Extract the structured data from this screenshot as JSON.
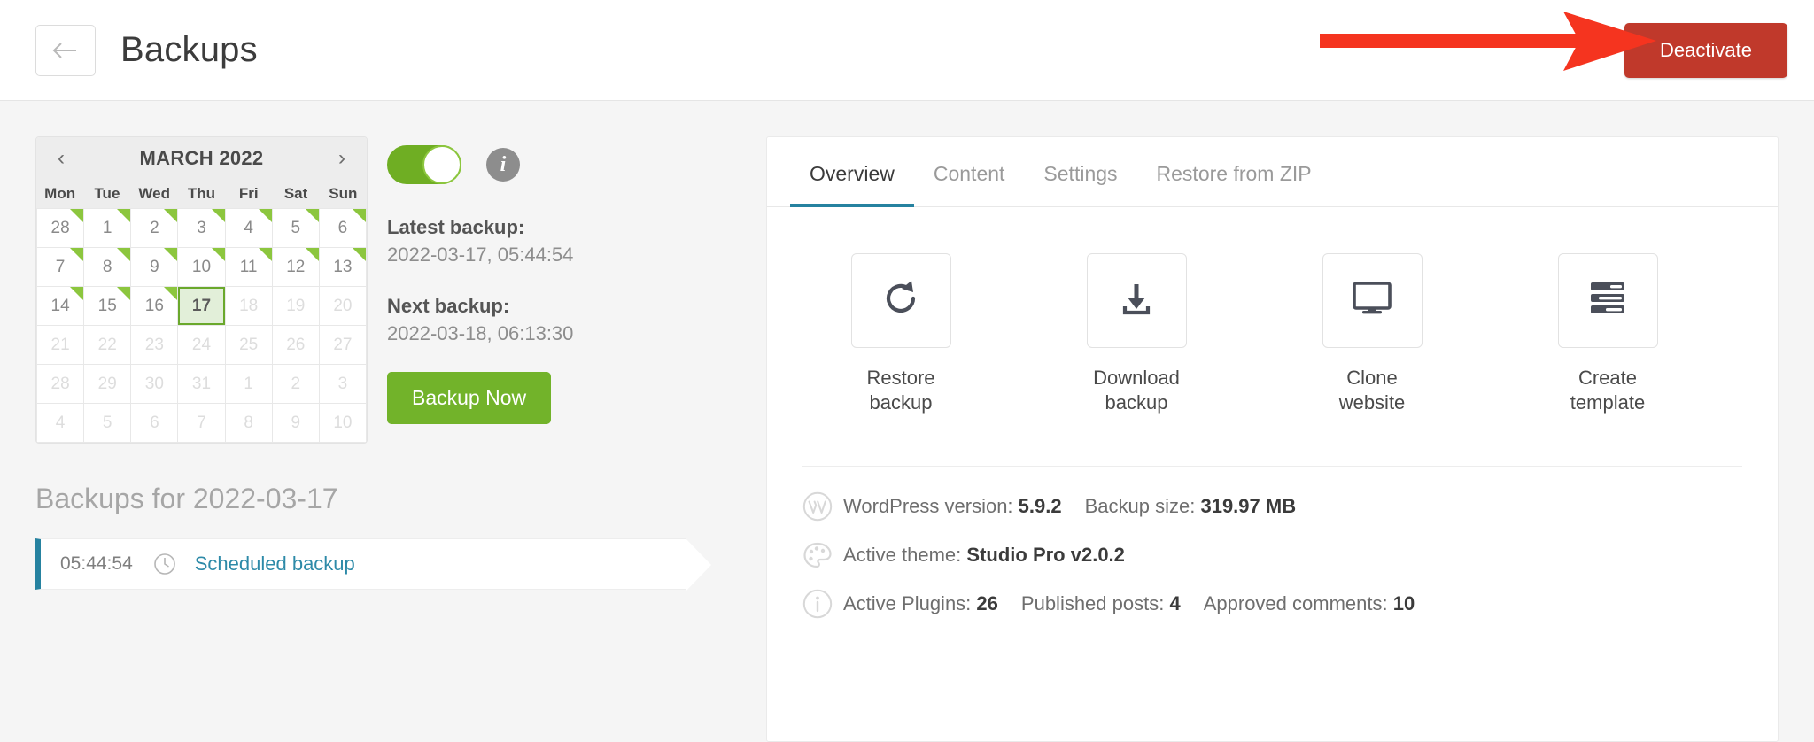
{
  "topbar": {
    "back_icon": "arrow-left-icon",
    "title": "Backups",
    "deactivate_label": "Deactivate",
    "accent_red": "#c0392b",
    "annotation_arrow_color": "#f5341f"
  },
  "calendar": {
    "prev_label": "‹",
    "next_label": "›",
    "month_label": "MARCH 2022",
    "dow": [
      "Mon",
      "Tue",
      "Wed",
      "Thu",
      "Fri",
      "Sat",
      "Sun"
    ],
    "selected_day": "17",
    "weeks": [
      [
        {
          "d": "28",
          "backup": true,
          "muted": false
        },
        {
          "d": "1",
          "backup": true,
          "muted": false
        },
        {
          "d": "2",
          "backup": true,
          "muted": false
        },
        {
          "d": "3",
          "backup": true,
          "muted": false
        },
        {
          "d": "4",
          "backup": true,
          "muted": false
        },
        {
          "d": "5",
          "backup": true,
          "muted": false
        },
        {
          "d": "6",
          "backup": true,
          "muted": false
        }
      ],
      [
        {
          "d": "7",
          "backup": true,
          "muted": false
        },
        {
          "d": "8",
          "backup": true,
          "muted": false
        },
        {
          "d": "9",
          "backup": true,
          "muted": false
        },
        {
          "d": "10",
          "backup": true,
          "muted": false
        },
        {
          "d": "11",
          "backup": true,
          "muted": false
        },
        {
          "d": "12",
          "backup": true,
          "muted": false
        },
        {
          "d": "13",
          "backup": true,
          "muted": false
        }
      ],
      [
        {
          "d": "14",
          "backup": true,
          "muted": false
        },
        {
          "d": "15",
          "backup": true,
          "muted": false
        },
        {
          "d": "16",
          "backup": true,
          "muted": false
        },
        {
          "d": "17",
          "backup": false,
          "muted": false,
          "selected": true
        },
        {
          "d": "18",
          "backup": false,
          "muted": true
        },
        {
          "d": "19",
          "backup": false,
          "muted": true
        },
        {
          "d": "20",
          "backup": false,
          "muted": true
        }
      ],
      [
        {
          "d": "21",
          "backup": false,
          "muted": true
        },
        {
          "d": "22",
          "backup": false,
          "muted": true
        },
        {
          "d": "23",
          "backup": false,
          "muted": true
        },
        {
          "d": "24",
          "backup": false,
          "muted": true
        },
        {
          "d": "25",
          "backup": false,
          "muted": true
        },
        {
          "d": "26",
          "backup": false,
          "muted": true
        },
        {
          "d": "27",
          "backup": false,
          "muted": true
        }
      ],
      [
        {
          "d": "28",
          "backup": false,
          "muted": true
        },
        {
          "d": "29",
          "backup": false,
          "muted": true
        },
        {
          "d": "30",
          "backup": false,
          "muted": true
        },
        {
          "d": "31",
          "backup": false,
          "muted": true
        },
        {
          "d": "1",
          "backup": false,
          "muted": true
        },
        {
          "d": "2",
          "backup": false,
          "muted": true
        },
        {
          "d": "3",
          "backup": false,
          "muted": true
        }
      ],
      [
        {
          "d": "4",
          "backup": false,
          "muted": true
        },
        {
          "d": "5",
          "backup": false,
          "muted": true
        },
        {
          "d": "6",
          "backup": false,
          "muted": true
        },
        {
          "d": "7",
          "backup": false,
          "muted": true
        },
        {
          "d": "8",
          "backup": false,
          "muted": true
        },
        {
          "d": "9",
          "backup": false,
          "muted": true
        },
        {
          "d": "10",
          "backup": false,
          "muted": true
        }
      ]
    ]
  },
  "schedule": {
    "toggle_on": true,
    "toggle_color": "#6fae23",
    "info_icon": "info-icon",
    "latest_label": "Latest backup:",
    "latest_value": "2022-03-17, 05:44:54",
    "next_label": "Next backup:",
    "next_value": "2022-03-18, 06:13:30",
    "backup_now_label": "Backup Now",
    "backup_now_color": "#72b32a"
  },
  "backups_list": {
    "heading": "Backups for 2022-03-17",
    "rows": [
      {
        "time": "05:44:54",
        "icon": "clock-icon",
        "label": "Scheduled backup"
      }
    ],
    "accent": "#2682a0"
  },
  "panel": {
    "tabs": [
      {
        "label": "Overview",
        "active": true
      },
      {
        "label": "Content",
        "active": false
      },
      {
        "label": "Settings",
        "active": false
      },
      {
        "label": "Restore from ZIP",
        "active": false
      }
    ],
    "active_tab_color": "#2682a0",
    "actions": [
      {
        "icon": "restore-icon",
        "line1": "Restore",
        "line2": "backup"
      },
      {
        "icon": "download-icon",
        "line1": "Download",
        "line2": "backup"
      },
      {
        "icon": "monitor-icon",
        "line1": "Clone",
        "line2": "website"
      },
      {
        "icon": "template-icon",
        "line1": "Create",
        "line2": "template"
      }
    ],
    "info": {
      "row1_icon": "wordpress-icon",
      "row1_label_a": "WordPress version:",
      "row1_value_a": "5.9.2",
      "row1_label_b": "Backup size:",
      "row1_value_b": "319.97 MB",
      "row2_icon": "palette-icon",
      "row2_label": "Active theme:",
      "row2_value": "Studio Pro v2.0.2",
      "row3_icon": "info-circle-icon",
      "row3_label_a": "Active Plugins:",
      "row3_value_a": "26",
      "row3_label_b": "Published posts:",
      "row3_value_b": "4",
      "row3_label_c": "Approved comments:",
      "row3_value_c": "10"
    }
  }
}
